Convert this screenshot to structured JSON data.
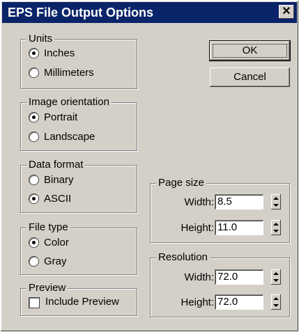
{
  "window": {
    "title": "EPS File Output Options",
    "close_glyph": "✕"
  },
  "units": {
    "legend": "Units",
    "options": [
      {
        "label": "Inches",
        "selected": true
      },
      {
        "label": "Millimeters",
        "selected": false
      }
    ]
  },
  "orientation": {
    "legend": "Image orientation",
    "options": [
      {
        "label": "Portrait",
        "selected": true
      },
      {
        "label": "Landscape",
        "selected": false
      }
    ]
  },
  "data_format": {
    "legend": "Data format",
    "options": [
      {
        "label": "Binary",
        "selected": false
      },
      {
        "label": "ASCII",
        "selected": true
      }
    ]
  },
  "file_type": {
    "legend": "File type",
    "options": [
      {
        "label": "Color",
        "selected": true
      },
      {
        "label": "Gray",
        "selected": false
      }
    ]
  },
  "preview": {
    "legend": "Preview",
    "checkbox_label": "Include Preview",
    "checked": false
  },
  "buttons": {
    "ok": "OK",
    "cancel": "Cancel"
  },
  "page_size": {
    "legend": "Page size",
    "width_label": "Width:",
    "width_value": "8.5",
    "height_label": "Height:",
    "height_value": "11.0"
  },
  "resolution": {
    "legend": "Resolution",
    "width_label": "Width:",
    "width_value": "72.0",
    "height_label": "Height:",
    "height_value": "72.0"
  }
}
